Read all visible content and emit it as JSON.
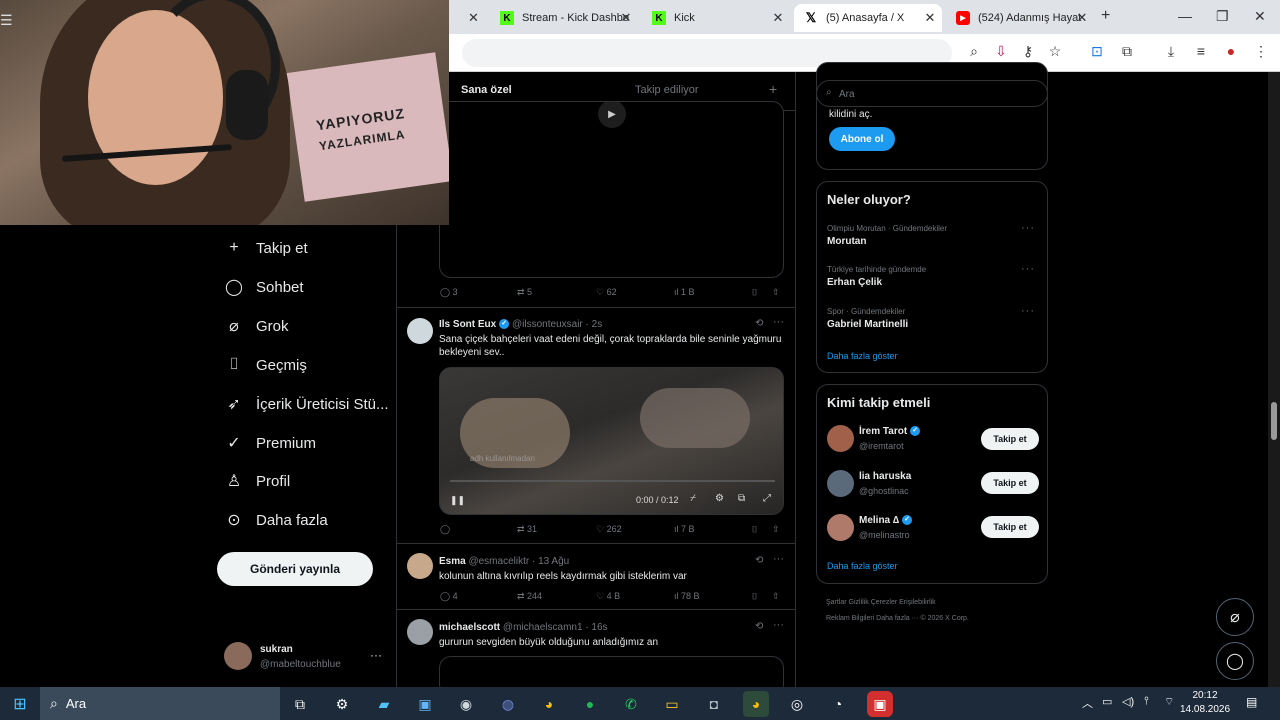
{
  "browser": {
    "tabs": [
      {
        "label": "Stream - Kick Dashbo",
        "icon": "kick-icon"
      },
      {
        "label": "Kick",
        "icon": "kick-icon"
      },
      {
        "label": "(5) Anasayfa / X",
        "icon": "x-icon"
      },
      {
        "label": "(524) Adanmış Hayat",
        "icon": "youtube-icon"
      }
    ]
  },
  "feed": {
    "tabs": [
      "Sana özel",
      "Takip ediliyor"
    ],
    "tweets": [
      {
        "reply": "3",
        "retweet": "5",
        "like": "62",
        "views": "1 B"
      },
      {
        "name": "Ils Sont Eux",
        "handle": "@ilssonteuxsair · 2s",
        "text": "Sana çiçek bahçeleri vaat edeni değil, çorak topraklarda bile seninle yağmuru bekleyeni sev..",
        "video_time": "0:00 / 0:12",
        "watermark": "adh kullanılmadan",
        "retweet": "31",
        "like": "262",
        "views": "7 B"
      },
      {
        "name": "Esma",
        "handle": "@esmaceliktr · 13 Ağu",
        "text": "kolunun altına kıvrılıp reels kaydırmak gibi isteklerim var",
        "reply": "4",
        "retweet": "244",
        "like": "4 B",
        "views": "78 B"
      },
      {
        "name": "michaelscott",
        "handle": "@michaelscamn1 · 16s",
        "text": "gururun sevgiden büyük olduğunu anladığımız an"
      }
    ]
  },
  "nav": {
    "items": [
      "Takip et",
      "Sohbet",
      "Grok",
      "Geçmiş",
      "İçerik Üreticisi Stü...",
      "Premium",
      "Profil",
      "Daha fazla"
    ],
    "post_button": "Gönderi yayınla",
    "user_name": "sukran",
    "user_handle": "@mabeltouchblue"
  },
  "webcam": {
    "wall_text": [
      "YAPIYORUZ",
      "YAZLARIMLA"
    ]
  },
  "sidebar": {
    "search_placeholder": "Ara",
    "premium_text": "kilidini aç.",
    "subscribe_button": "Abone ol",
    "trends_title": "Neler oluyor?",
    "trends": [
      {
        "meta": "Olimpiu Morutan · Gündemdekiler",
        "title": "Morutan"
      },
      {
        "meta": "Türkiye tarihinde gündemde",
        "title": "Erhan Çelik"
      },
      {
        "meta": "Spor · Gündemdekiler",
        "title": "Gabriel Martinelli"
      }
    ],
    "show_more": "Daha fazla göster",
    "who_to_follow_title": "Kimi takip etmeli",
    "follow_suggestions": [
      {
        "name": "İrem Tarot",
        "handle": "@iremtarot",
        "verified": true
      },
      {
        "name": "lia haruska",
        "handle": "@ghostlinac",
        "verified": false
      },
      {
        "name": "Melina ∆",
        "handle": "@melinastro",
        "verified": true
      }
    ],
    "follow_label": "Takip et",
    "footer_line1": "Şartlar     Gizlilik     Çerezler     Erişilebilirlik",
    "footer_line2": "Reklam Bilgileri     Daha fazla ···     © 2026 X Corp."
  },
  "taskbar": {
    "search_label": "Ara",
    "time": "20:12",
    "date": "14.08.2026"
  },
  "colors": {
    "accent": "#1d9bf0",
    "background": "#000000",
    "border": "#2f3336",
    "muted": "#71767b",
    "kick": "#53fc18",
    "youtube": "#ff0000"
  }
}
